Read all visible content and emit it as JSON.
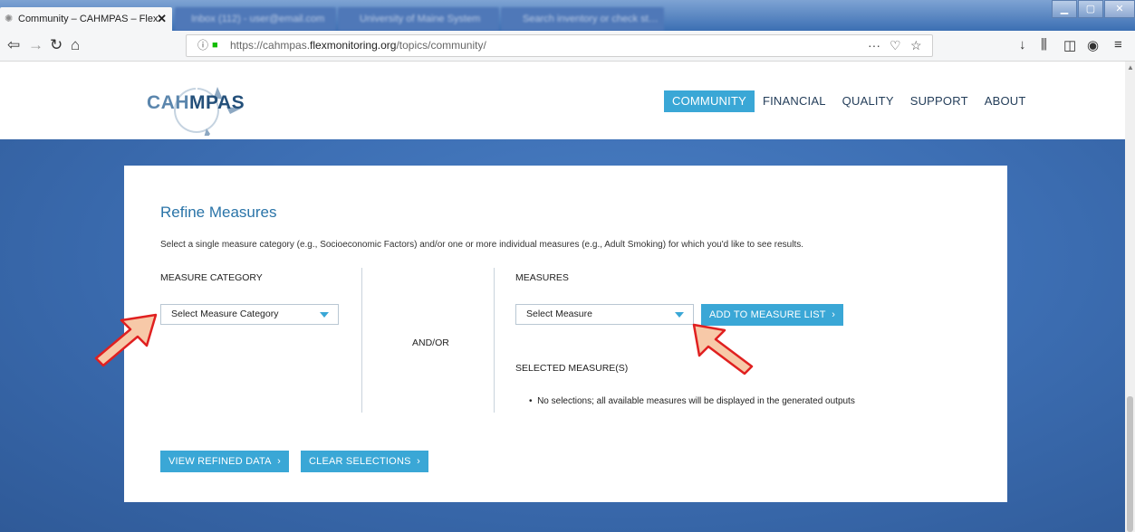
{
  "browser": {
    "tabs": [
      {
        "title": "Community – CAHMPAS – Flex"
      },
      {
        "title": "Inbox (112) - user@email.com"
      },
      {
        "title": "University of Maine System"
      },
      {
        "title": "Search inventory or check st…"
      }
    ],
    "url_prefix": "https://cahmpas.",
    "url_domain": "flexmonitoring.org",
    "url_path": "/topics/community/",
    "page_actions": "···"
  },
  "site": {
    "logo_dark": "CAH",
    "logo_light": "MPAS",
    "nav": [
      {
        "label": "COMMUNITY"
      },
      {
        "label": "FINANCIAL"
      },
      {
        "label": "QUALITY"
      },
      {
        "label": "SUPPORT"
      },
      {
        "label": "ABOUT"
      }
    ]
  },
  "refine": {
    "title": "Refine Measures",
    "intro": "Select a single measure category (e.g., Socioeconomic Factors) and/or one or more individual measures (e.g., Adult Smoking) for which you'd like to see results.",
    "category_label": "MEASURE CATEGORY",
    "category_select": "Select Measure Category",
    "andor": "AND/OR",
    "measures_label": "MEASURES",
    "measure_select": "Select Measure",
    "add_button": "ADD TO MEASURE LIST",
    "selected_label": "SELECTED MEASURE(S)",
    "no_selection": "No selections; all available measures will be displayed in the generated outputs",
    "view_button": "VIEW REFINED DATA",
    "clear_button": "CLEAR SELECTIONS"
  },
  "colors": {
    "accent": "#3aa7d6",
    "hero": "#3d6fb4",
    "arrow_fill": "#f7c9a8",
    "arrow_stroke": "#e02020"
  }
}
